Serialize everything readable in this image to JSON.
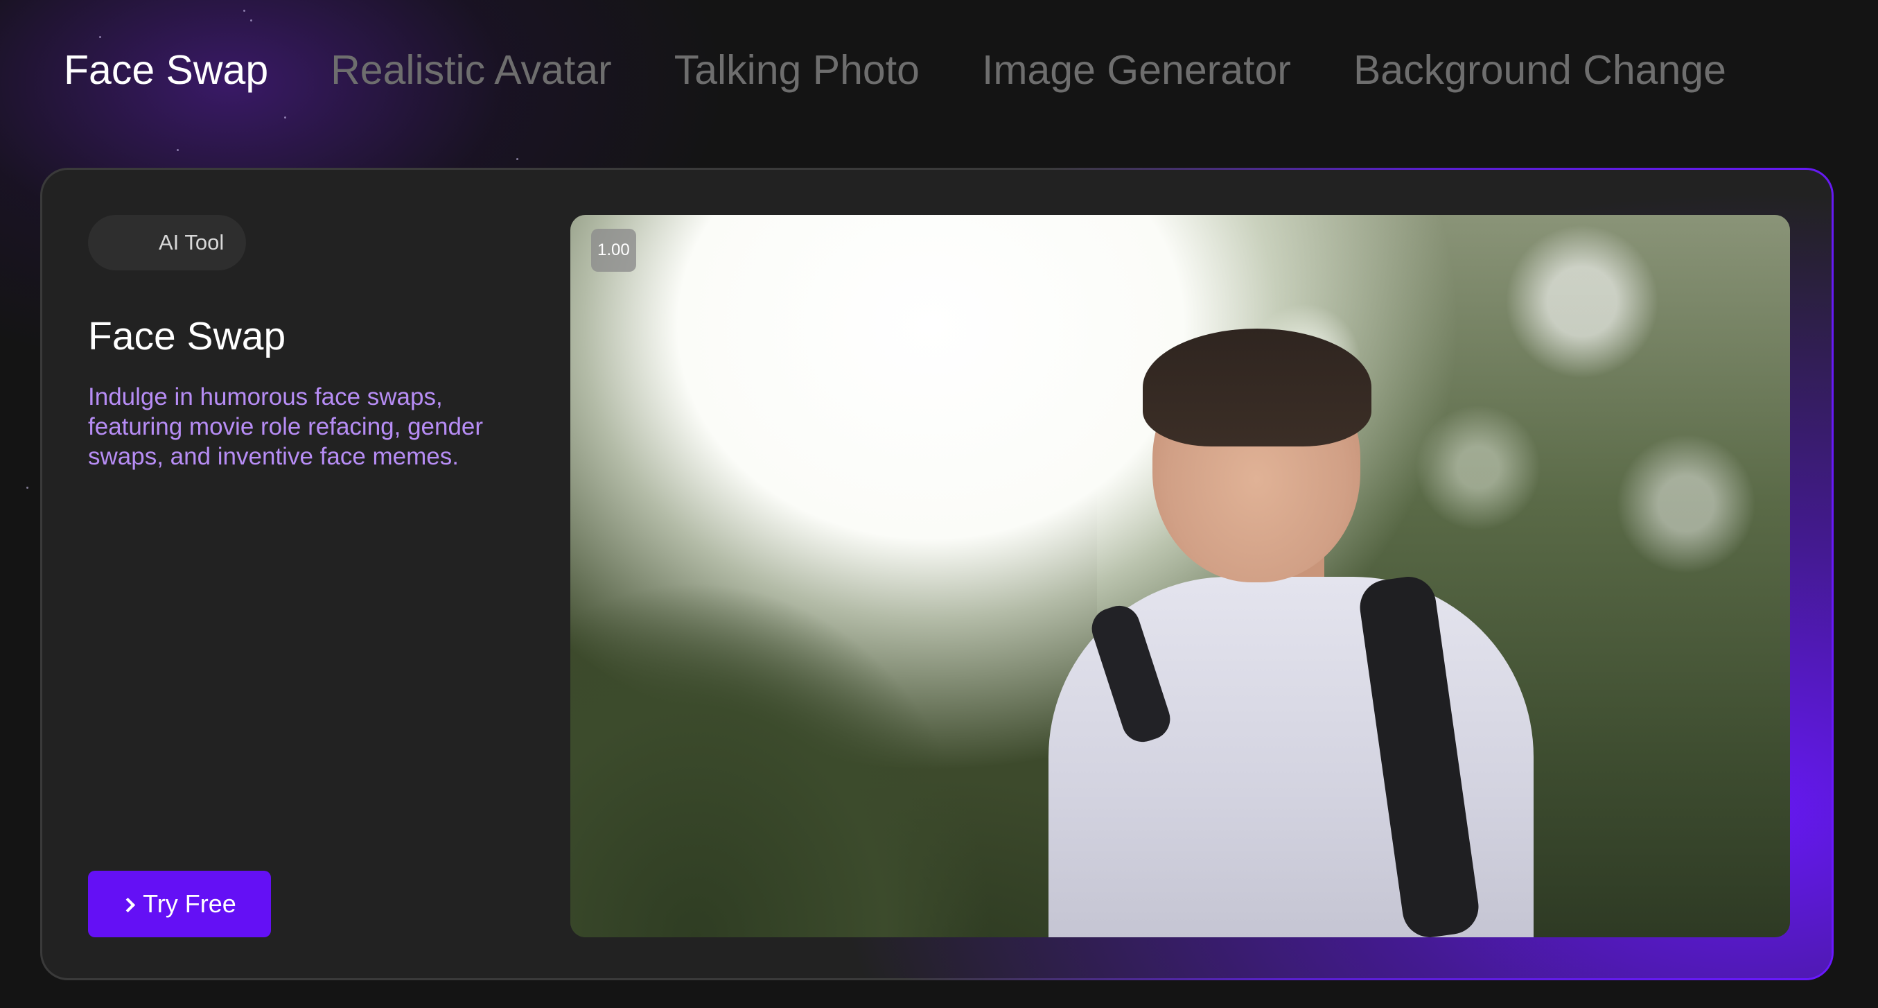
{
  "tabs": [
    {
      "label": "Face Swap",
      "active": true
    },
    {
      "label": "Realistic Avatar",
      "active": false
    },
    {
      "label": "Talking Photo",
      "active": false
    },
    {
      "label": "Image Generator",
      "active": false
    },
    {
      "label": "Background Change",
      "active": false
    }
  ],
  "card": {
    "badge": "AI Tool",
    "title": "Face Swap",
    "description": "Indulge in humorous face swaps, featuring movie role refacing, gender swaps, and inventive face memes.",
    "cta_label": "Try Free",
    "cta_icon": "chevron-right-icon"
  },
  "preview": {
    "playback_speed": "1.00"
  },
  "colors": {
    "background": "#141414",
    "card": "#222222",
    "accent": "#6410f5",
    "description": "#b78df5",
    "tab_inactive": "#6e6e6e",
    "tab_active": "#ffffff"
  }
}
